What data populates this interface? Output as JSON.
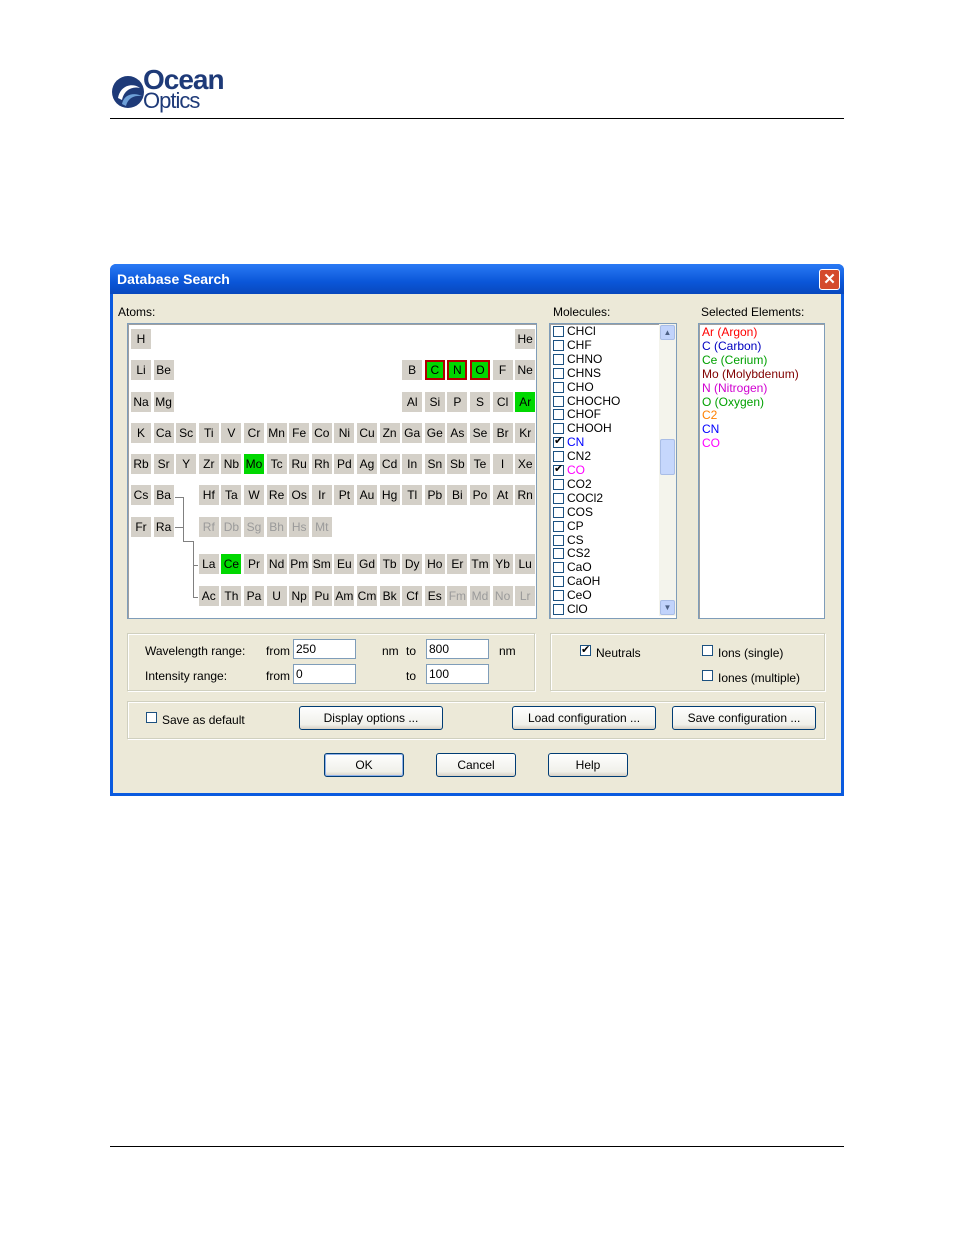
{
  "header": {
    "logo_line1": "Ocean",
    "logo_line2": "Optics"
  },
  "dialog": {
    "title": "Database Search",
    "close_glyph": "✕",
    "atoms_label": "Atoms:",
    "molecules_label": "Molecules:",
    "selected_label": "Selected Elements:",
    "periodic_table": [
      {
        "s": "H",
        "r": 0,
        "c": 0
      },
      {
        "s": "He",
        "r": 0,
        "c": 17
      },
      {
        "s": "Li",
        "r": 1,
        "c": 0
      },
      {
        "s": "Be",
        "r": 1,
        "c": 1
      },
      {
        "s": "B",
        "r": 1,
        "c": 12
      },
      {
        "s": "C",
        "r": 1,
        "c": 13,
        "sel": true,
        "outlined": true
      },
      {
        "s": "N",
        "r": 1,
        "c": 14,
        "sel": true,
        "outlined": true
      },
      {
        "s": "O",
        "r": 1,
        "c": 15,
        "sel": true,
        "outlined": true
      },
      {
        "s": "F",
        "r": 1,
        "c": 16
      },
      {
        "s": "Ne",
        "r": 1,
        "c": 17
      },
      {
        "s": "Na",
        "r": 2,
        "c": 0
      },
      {
        "s": "Mg",
        "r": 2,
        "c": 1
      },
      {
        "s": "Al",
        "r": 2,
        "c": 12
      },
      {
        "s": "Si",
        "r": 2,
        "c": 13
      },
      {
        "s": "P",
        "r": 2,
        "c": 14
      },
      {
        "s": "S",
        "r": 2,
        "c": 15
      },
      {
        "s": "Cl",
        "r": 2,
        "c": 16
      },
      {
        "s": "Ar",
        "r": 2,
        "c": 17,
        "sel": true
      },
      {
        "s": "K",
        "r": 3,
        "c": 0
      },
      {
        "s": "Ca",
        "r": 3,
        "c": 1
      },
      {
        "s": "Sc",
        "r": 3,
        "c": 2
      },
      {
        "s": "Ti",
        "r": 3,
        "c": 3
      },
      {
        "s": "V",
        "r": 3,
        "c": 4
      },
      {
        "s": "Cr",
        "r": 3,
        "c": 5
      },
      {
        "s": "Mn",
        "r": 3,
        "c": 6
      },
      {
        "s": "Fe",
        "r": 3,
        "c": 7
      },
      {
        "s": "Co",
        "r": 3,
        "c": 8
      },
      {
        "s": "Ni",
        "r": 3,
        "c": 9
      },
      {
        "s": "Cu",
        "r": 3,
        "c": 10
      },
      {
        "s": "Zn",
        "r": 3,
        "c": 11
      },
      {
        "s": "Ga",
        "r": 3,
        "c": 12
      },
      {
        "s": "Ge",
        "r": 3,
        "c": 13
      },
      {
        "s": "As",
        "r": 3,
        "c": 14
      },
      {
        "s": "Se",
        "r": 3,
        "c": 15
      },
      {
        "s": "Br",
        "r": 3,
        "c": 16
      },
      {
        "s": "Kr",
        "r": 3,
        "c": 17
      },
      {
        "s": "Rb",
        "r": 4,
        "c": 0
      },
      {
        "s": "Sr",
        "r": 4,
        "c": 1
      },
      {
        "s": "Y",
        "r": 4,
        "c": 2
      },
      {
        "s": "Zr",
        "r": 4,
        "c": 3
      },
      {
        "s": "Nb",
        "r": 4,
        "c": 4
      },
      {
        "s": "Mo",
        "r": 4,
        "c": 5,
        "sel": true
      },
      {
        "s": "Tc",
        "r": 4,
        "c": 6
      },
      {
        "s": "Ru",
        "r": 4,
        "c": 7
      },
      {
        "s": "Rh",
        "r": 4,
        "c": 8
      },
      {
        "s": "Pd",
        "r": 4,
        "c": 9
      },
      {
        "s": "Ag",
        "r": 4,
        "c": 10
      },
      {
        "s": "Cd",
        "r": 4,
        "c": 11
      },
      {
        "s": "In",
        "r": 4,
        "c": 12
      },
      {
        "s": "Sn",
        "r": 4,
        "c": 13
      },
      {
        "s": "Sb",
        "r": 4,
        "c": 14
      },
      {
        "s": "Te",
        "r": 4,
        "c": 15
      },
      {
        "s": "I",
        "r": 4,
        "c": 16
      },
      {
        "s": "Xe",
        "r": 4,
        "c": 17
      },
      {
        "s": "Cs",
        "r": 5,
        "c": 0
      },
      {
        "s": "Ba",
        "r": 5,
        "c": 1
      },
      {
        "s": "Hf",
        "r": 5,
        "c": 3
      },
      {
        "s": "Ta",
        "r": 5,
        "c": 4
      },
      {
        "s": "W",
        "r": 5,
        "c": 5
      },
      {
        "s": "Re",
        "r": 5,
        "c": 6
      },
      {
        "s": "Os",
        "r": 5,
        "c": 7
      },
      {
        "s": "Ir",
        "r": 5,
        "c": 8
      },
      {
        "s": "Pt",
        "r": 5,
        "c": 9
      },
      {
        "s": "Au",
        "r": 5,
        "c": 10
      },
      {
        "s": "Hg",
        "r": 5,
        "c": 11
      },
      {
        "s": "Tl",
        "r": 5,
        "c": 12
      },
      {
        "s": "Pb",
        "r": 5,
        "c": 13
      },
      {
        "s": "Bi",
        "r": 5,
        "c": 14
      },
      {
        "s": "Po",
        "r": 5,
        "c": 15
      },
      {
        "s": "At",
        "r": 5,
        "c": 16
      },
      {
        "s": "Rn",
        "r": 5,
        "c": 17
      },
      {
        "s": "Fr",
        "r": 6,
        "c": 0
      },
      {
        "s": "Ra",
        "r": 6,
        "c": 1
      },
      {
        "s": "Rf",
        "r": 6,
        "c": 3,
        "dim": true
      },
      {
        "s": "Db",
        "r": 6,
        "c": 4,
        "dim": true
      },
      {
        "s": "Sg",
        "r": 6,
        "c": 5,
        "dim": true
      },
      {
        "s": "Bh",
        "r": 6,
        "c": 6,
        "dim": true
      },
      {
        "s": "Hs",
        "r": 6,
        "c": 7,
        "dim": true
      },
      {
        "s": "Mt",
        "r": 6,
        "c": 8,
        "dim": true
      },
      {
        "s": "La",
        "r": 7,
        "c": 3
      },
      {
        "s": "Ce",
        "r": 7,
        "c": 4,
        "sel": true
      },
      {
        "s": "Pr",
        "r": 7,
        "c": 5
      },
      {
        "s": "Nd",
        "r": 7,
        "c": 6
      },
      {
        "s": "Pm",
        "r": 7,
        "c": 7
      },
      {
        "s": "Sm",
        "r": 7,
        "c": 8
      },
      {
        "s": "Eu",
        "r": 7,
        "c": 9
      },
      {
        "s": "Gd",
        "r": 7,
        "c": 10
      },
      {
        "s": "Tb",
        "r": 7,
        "c": 11
      },
      {
        "s": "Dy",
        "r": 7,
        "c": 12
      },
      {
        "s": "Ho",
        "r": 7,
        "c": 13
      },
      {
        "s": "Er",
        "r": 7,
        "c": 14
      },
      {
        "s": "Tm",
        "r": 7,
        "c": 15
      },
      {
        "s": "Yb",
        "r": 7,
        "c": 16
      },
      {
        "s": "Lu",
        "r": 7,
        "c": 17
      },
      {
        "s": "Ac",
        "r": 8,
        "c": 3
      },
      {
        "s": "Th",
        "r": 8,
        "c": 4
      },
      {
        "s": "Pa",
        "r": 8,
        "c": 5
      },
      {
        "s": "U",
        "r": 8,
        "c": 6
      },
      {
        "s": "Np",
        "r": 8,
        "c": 7
      },
      {
        "s": "Pu",
        "r": 8,
        "c": 8
      },
      {
        "s": "Am",
        "r": 8,
        "c": 9
      },
      {
        "s": "Cm",
        "r": 8,
        "c": 10
      },
      {
        "s": "Bk",
        "r": 8,
        "c": 11
      },
      {
        "s": "Cf",
        "r": 8,
        "c": 12
      },
      {
        "s": "Es",
        "r": 8,
        "c": 13
      },
      {
        "s": "Fm",
        "r": 8,
        "c": 14,
        "dim": true
      },
      {
        "s": "Md",
        "r": 8,
        "c": 15,
        "dim": true
      },
      {
        "s": "No",
        "r": 8,
        "c": 16,
        "dim": true
      },
      {
        "s": "Lr",
        "r": 8,
        "c": 17,
        "dim": true
      }
    ],
    "molecules": [
      {
        "name": "CHCl",
        "checked": false
      },
      {
        "name": "CHF",
        "checked": false
      },
      {
        "name": "CHNO",
        "checked": false
      },
      {
        "name": "CHNS",
        "checked": false
      },
      {
        "name": "CHO",
        "checked": false
      },
      {
        "name": "CHOCHO",
        "checked": false
      },
      {
        "name": "CHOF",
        "checked": false
      },
      {
        "name": "CHOOH",
        "checked": false
      },
      {
        "name": "CN",
        "checked": true,
        "color": "#0000ff"
      },
      {
        "name": "CN2",
        "checked": false
      },
      {
        "name": "CO",
        "checked": true,
        "color": "#ff00ff"
      },
      {
        "name": "CO2",
        "checked": false
      },
      {
        "name": "COCl2",
        "checked": false
      },
      {
        "name": "COS",
        "checked": false
      },
      {
        "name": "CP",
        "checked": false
      },
      {
        "name": "CS",
        "checked": false
      },
      {
        "name": "CS2",
        "checked": false
      },
      {
        "name": "CaO",
        "checked": false
      },
      {
        "name": "CaOH",
        "checked": false
      },
      {
        "name": "CeO",
        "checked": false
      },
      {
        "name": "ClO",
        "checked": false
      }
    ],
    "selected_elements": [
      {
        "text": "Ar (Argon)",
        "color": "#ff0000"
      },
      {
        "text": "C (Carbon)",
        "color": "#0000c0"
      },
      {
        "text": "Ce (Cerium)",
        "color": "#00a000"
      },
      {
        "text": "Mo (Molybdenum)",
        "color": "#800000"
      },
      {
        "text": "N (Nitrogen)",
        "color": "#d000d0"
      },
      {
        "text": "O (Oxygen)",
        "color": "#00a000"
      },
      {
        "text": "C2",
        "color": "#ff8000"
      },
      {
        "text": "CN",
        "color": "#0000ff"
      },
      {
        "text": "CO",
        "color": "#ff00ff"
      }
    ],
    "wavelength_label": "Wavelength range:",
    "intensity_label": "Intensity range:",
    "from_label": "from",
    "to_label": "to",
    "nm_label": "nm",
    "wavelength_from": "250",
    "wavelength_to": "800",
    "intensity_from": "0",
    "intensity_to": "100",
    "neutrals_label": "Neutrals",
    "neutrals_checked": true,
    "ions_single_label": "Ions (single)",
    "ions_multiple_label": "Iones (multiple)",
    "save_default_label": "Save as default",
    "display_options_label": "Display options ...",
    "load_config_label": "Load configuration ...",
    "save_config_label": "Save configuration ...",
    "ok_label": "OK",
    "cancel_label": "Cancel",
    "help_label": "Help"
  }
}
